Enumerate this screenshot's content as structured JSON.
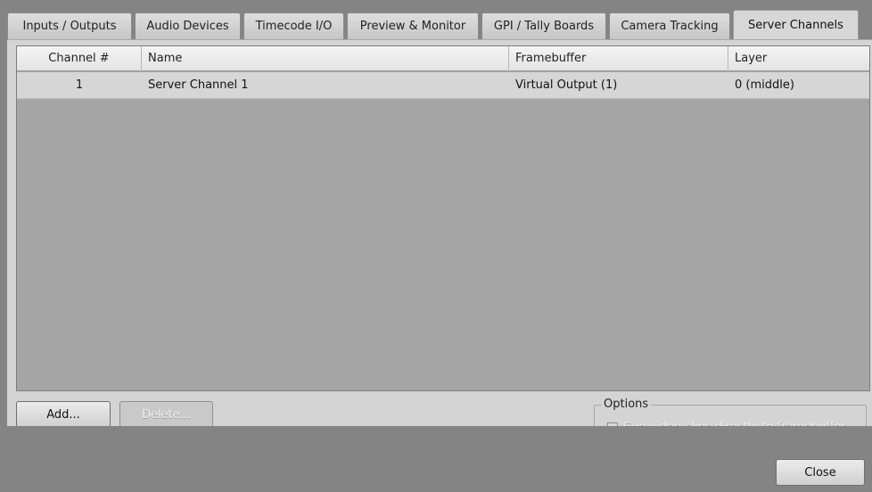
{
  "tabs": [
    {
      "label": "Inputs / Outputs"
    },
    {
      "label": "Audio Devices"
    },
    {
      "label": "Timecode I/O"
    },
    {
      "label": "Preview & Monitor"
    },
    {
      "label": "GPI / Tally Boards"
    },
    {
      "label": "Camera Tracking"
    },
    {
      "label": "Server Channels"
    }
  ],
  "table": {
    "columns": [
      "Channel #",
      "Name",
      "Framebuffer",
      "Layer"
    ],
    "rows": [
      {
        "channel": "1",
        "name": "Server Channel 1",
        "framebuffer": "Virtual Output (1)",
        "layer": "0 (middle)"
      }
    ]
  },
  "buttons": {
    "add": "Add...",
    "delete": "Delete...",
    "close": "Close"
  },
  "options": {
    "legend": "Options",
    "cue_label": "Cue video clips directly to framebuffer",
    "cue_checked": false
  }
}
